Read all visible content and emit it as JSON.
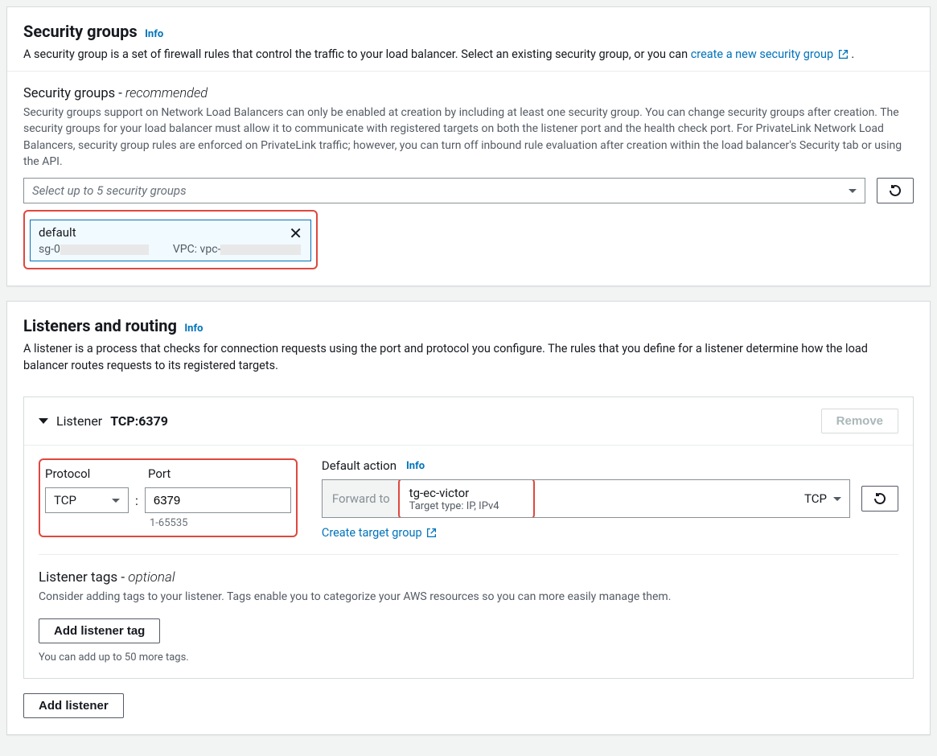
{
  "securityGroups": {
    "title": "Security groups",
    "infoLabel": "Info",
    "introText": "A security group is a set of firewall rules that control the traffic to your load balancer. Select an existing security group, or you can ",
    "createLinkText": "create a new security group",
    "period": ".",
    "subheading": "Security groups - ",
    "subheadingItalic": "recommended",
    "description": "Security groups support on Network Load Balancers can only be enabled at creation by including at least one security group. You can change security groups after creation. The security groups for your load balancer must allow it to communicate with registered targets on both the listener port and the health check port. For PrivateLink Network Load Balancers, security group rules are enforced on PrivateLink traffic; however, you can turn off inbound rule evaluation after creation within the load balancer's Security tab or using the API.",
    "selectPlaceholder": "Select up to 5 security groups",
    "chipName": "default",
    "chipSgPrefix": "sg-0",
    "chipVpcPrefix": "VPC: vpc-"
  },
  "listeners": {
    "title": "Listeners and routing",
    "infoLabel": "Info",
    "introText": "A listener is a process that checks for connection requests using the port and protocol you configure. The rules that you define for a listener determine how the load balancer routes requests to its registered targets.",
    "listenerLabel": "Listener",
    "listenerValue": "TCP:6379",
    "removeLabel": "Remove",
    "protocolLabel": "Protocol",
    "portLabel": "Port",
    "protocolValue": "TCP",
    "portValue": "6379",
    "portHint": "1-65535",
    "defaultActionLabel": "Default action",
    "forwardToLabel": "Forward to",
    "targetGroupName": "tg-ec-victor",
    "targetGroupSub": "Target type: IP, IPv4",
    "targetGroupProtocol": "TCP",
    "createTargetGroupLabel": "Create target group",
    "listenerTagsTitle": "Listener tags - ",
    "listenerTagsItalic": "optional",
    "listenerTagsDesc": "Consider adding tags to your listener. Tags enable you to categorize your AWS resources so you can more easily manage them.",
    "addListenerTagLabel": "Add listener tag",
    "tagNote": "You can add up to 50 more tags.",
    "addListenerLabel": "Add listener"
  }
}
